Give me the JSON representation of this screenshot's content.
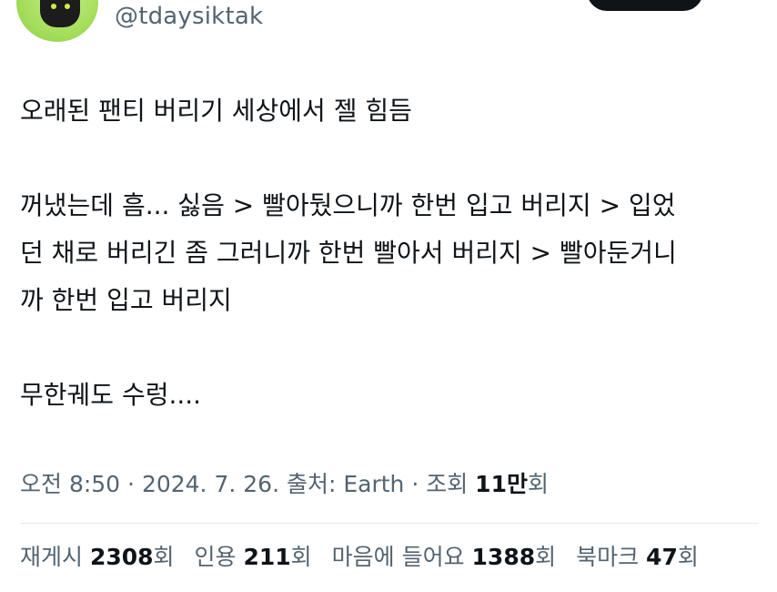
{
  "author": {
    "handle": "@tdaysiktak",
    "avatar_icon": "black-cat-avatar-icon"
  },
  "tweet": {
    "line1": "오래된 팬티 버리기 세상에서 젤 힘듬",
    "paragraph2_line1": "꺼냈는데 흠... 싫음 > 빨아뒀으니까 한번 입고 버리지 > 입었",
    "paragraph2_line2": "던 채로 버리긴 좀 그러니까 한번 빨아서 버리지 > 빨아둔거니",
    "paragraph2_line3": "까 한번 입고 버리지",
    "line_last": "무한궤도 수렁...."
  },
  "meta": {
    "time": "오전 8:50",
    "sep1": " · ",
    "date": "2024. 7. 26.",
    "source_label": " 출처: Earth",
    "sep2": " · ",
    "views_label": "조회 ",
    "views_count": "11만",
    "views_suffix": "회"
  },
  "stats": {
    "retweets_label": "재게시 ",
    "retweets_count": "2308",
    "retweets_suffix": "회",
    "quotes_label": "인용 ",
    "quotes_count": "211",
    "quotes_suffix": "회",
    "likes_label": "마음에 들어요 ",
    "likes_count": "1388",
    "likes_suffix": "회",
    "bookmarks_label": "북마크 ",
    "bookmarks_count": "47",
    "bookmarks_suffix": "회"
  },
  "colors": {
    "text_primary": "#0f1419",
    "text_secondary": "#536471",
    "divider": "#e6e9eb",
    "avatar_bg": "#a9df5f"
  }
}
